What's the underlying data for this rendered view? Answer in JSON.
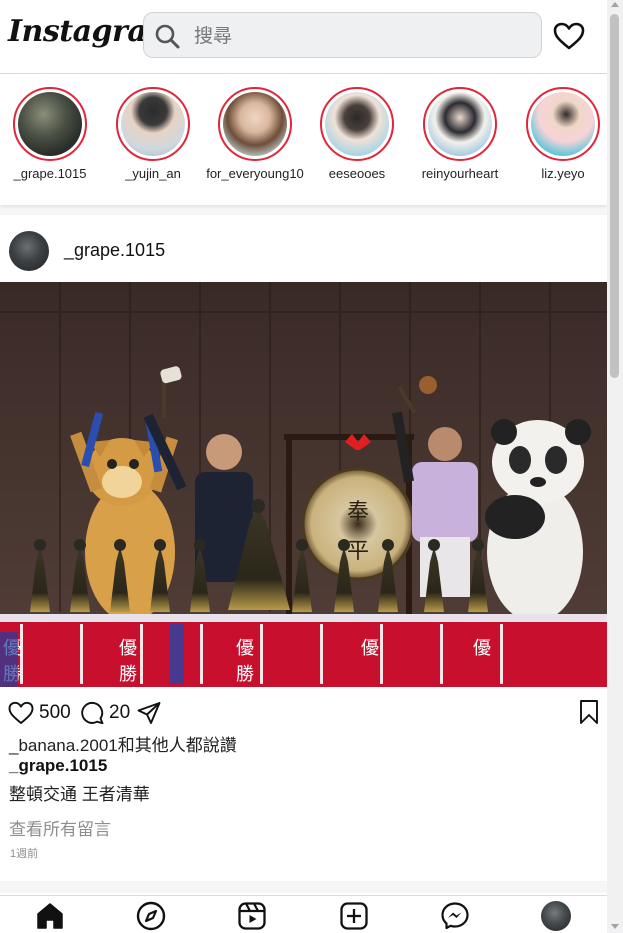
{
  "header": {
    "logo_text": "Instagram",
    "search_placeholder": "搜尋",
    "icons": [
      "search-icon",
      "heart-icon"
    ]
  },
  "stories": [
    {
      "username": "_grape.1015"
    },
    {
      "username": "_yujin_an"
    },
    {
      "username": "for_everyoung10"
    },
    {
      "username": "eeseooes"
    },
    {
      "username": "reinyourheart"
    },
    {
      "username": "liz.yeyo"
    }
  ],
  "post": {
    "username": "_grape.1015",
    "likes": "500",
    "comments": "20",
    "liked_by_text": "_banana.2001和其他人都說讚",
    "caption_user": "_grape.1015",
    "caption_text": "整頓交通 王者清華",
    "view_comments": "查看所有留言",
    "time": "1週前",
    "image_signage": {
      "banner_char_1": "優",
      "banner_char_2": "勝",
      "gong_char_1": "奉",
      "gong_char_2": "平"
    }
  },
  "bottom_nav": {
    "items": [
      "home-icon",
      "explore-icon",
      "reels-icon",
      "create-icon",
      "messenger-icon",
      "profile-avatar"
    ]
  },
  "colors": {
    "story_ring": "#e0263a",
    "muted_text": "#8e8e8e",
    "banner_red": "#c8102e"
  }
}
